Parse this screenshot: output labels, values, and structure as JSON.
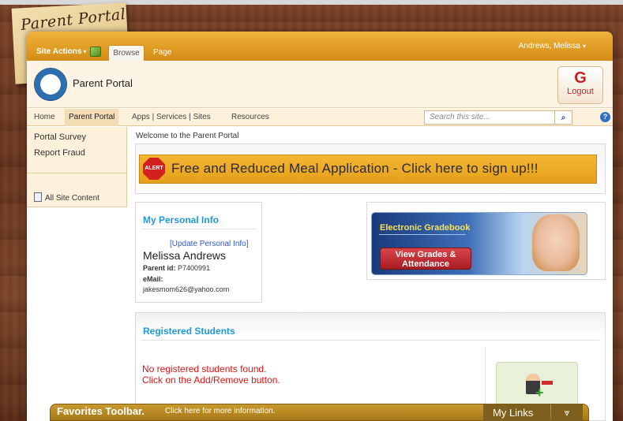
{
  "colors": {
    "ribbon": "#e2a028",
    "accent_blue": "#1f9ad6",
    "alert_orange": "#f0ad2a",
    "error_red": "#e01414"
  },
  "branding": {
    "sticky_title": "Parent Portal",
    "site_title": "Parent Portal"
  },
  "ribbon": {
    "site_actions": "Site Actions",
    "tabs": [
      "Browse",
      "Page"
    ],
    "user": "Andrews, Melissa"
  },
  "logout": {
    "label": "Logout",
    "icon": "logout-icon"
  },
  "nav": {
    "items": [
      "Home",
      "Parent Portal",
      "Apps | Services | Sites",
      "Resources"
    ],
    "search_placeholder": "Search this site...",
    "help_icon": "?"
  },
  "quick_launch": {
    "items": [
      "Portal Survey",
      "Report Fraud"
    ],
    "all_content": "All Site Content"
  },
  "main": {
    "welcome": "Welcome to the Parent Portal",
    "alert": {
      "icon_text": "ALERT",
      "text": "Free and Reduced Meal Application - Click here to sign up!!!"
    },
    "personal_info": {
      "title": "My Personal Info",
      "update_link": "[Update Personal Info]",
      "name": "Melissa Andrews",
      "parent_id_label": "Parent id:",
      "parent_id": "P7400991",
      "email_label": "eMail:",
      "email": "jakesmom626@yahoo.com"
    },
    "gradebook": {
      "title": "Electronic Gradebook",
      "button_line1": "View Grades &",
      "button_line2": "Attendance"
    },
    "registered": {
      "title": "Registered Students",
      "msg1": "No registered students found.",
      "msg2": "Click on the Add/Remove button."
    }
  },
  "favorites": {
    "title": "Favorites Toolbar.",
    "subtitle": "Click here for more information.",
    "my_links": "My Links"
  }
}
